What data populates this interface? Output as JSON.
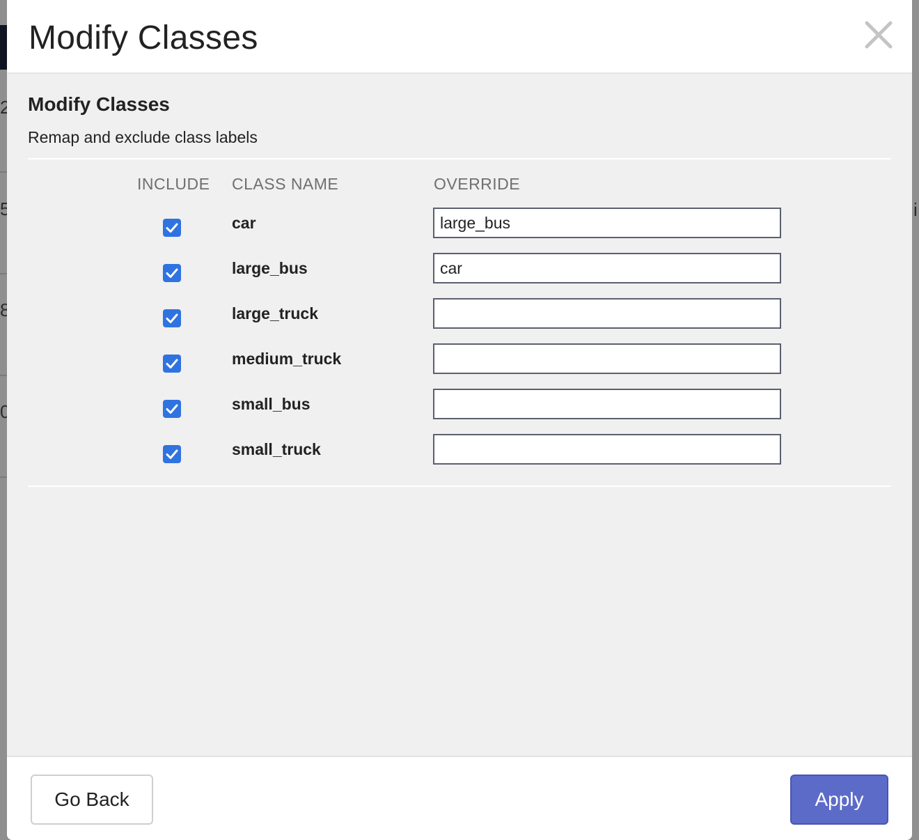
{
  "background": {
    "left_fragments": [
      "2",
      "5",
      "8",
      "0"
    ],
    "right_fragment": "i"
  },
  "modal": {
    "title": "Modify Classes",
    "close_icon": "close-x-icon",
    "section": {
      "title": "Modify Classes",
      "subtitle": "Remap and exclude class labels"
    },
    "table": {
      "headers": {
        "include": "INCLUDE",
        "class_name": "CLASS NAME",
        "override": "OVERRIDE"
      },
      "rows": [
        {
          "include": true,
          "class_name": "car",
          "override": "large_bus"
        },
        {
          "include": true,
          "class_name": "large_bus",
          "override": "car"
        },
        {
          "include": true,
          "class_name": "large_truck",
          "override": ""
        },
        {
          "include": true,
          "class_name": "medium_truck",
          "override": ""
        },
        {
          "include": true,
          "class_name": "small_bus",
          "override": ""
        },
        {
          "include": true,
          "class_name": "small_truck",
          "override": ""
        }
      ]
    },
    "footer": {
      "back_label": "Go Back",
      "apply_label": "Apply"
    }
  },
  "colors": {
    "checkbox": "#2f73e0",
    "apply_button": "#5d6bc8",
    "modal_body": "#f0f0f0"
  }
}
